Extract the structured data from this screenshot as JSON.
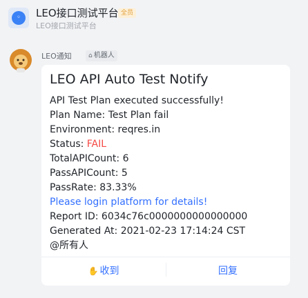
{
  "header": {
    "group_name": "LEO接口测试平台",
    "badge": "全员",
    "subtitle": "LEO接口测试平台"
  },
  "message": {
    "sender": "LEO通知",
    "bot_tag": "机器人",
    "card": {
      "title": "LEO API Auto Test Notify",
      "line1": "API Test Plan executed successfully!",
      "plan_line": "Plan Name: Test Plan fail",
      "env_line": "Environment: reqres.in",
      "status_label": "Status: ",
      "status_value": "FAIL",
      "total_line": "TotalAPICount: 6",
      "pass_line": "PassAPICount: 5",
      "rate_line": "PassRate: 83.33%",
      "link_line": "Please login platform for details!",
      "report_line": "Report ID: 6034c76c0000000000000000",
      "generated_line": "Generated At: 2021-02-23 17:14:24 CST",
      "mention_line": "@所有人"
    },
    "actions": {
      "received": "收到",
      "reply": "回复"
    }
  },
  "colors": {
    "accent": "#3370ff",
    "status_fail": "#f54a45",
    "badge_text": "#e3a03b"
  },
  "icons": {
    "group_avatar": "group-app-icon",
    "bot_avatar": "lion-icon",
    "bot_tag": "robot-icon",
    "received": "hand-icon"
  }
}
